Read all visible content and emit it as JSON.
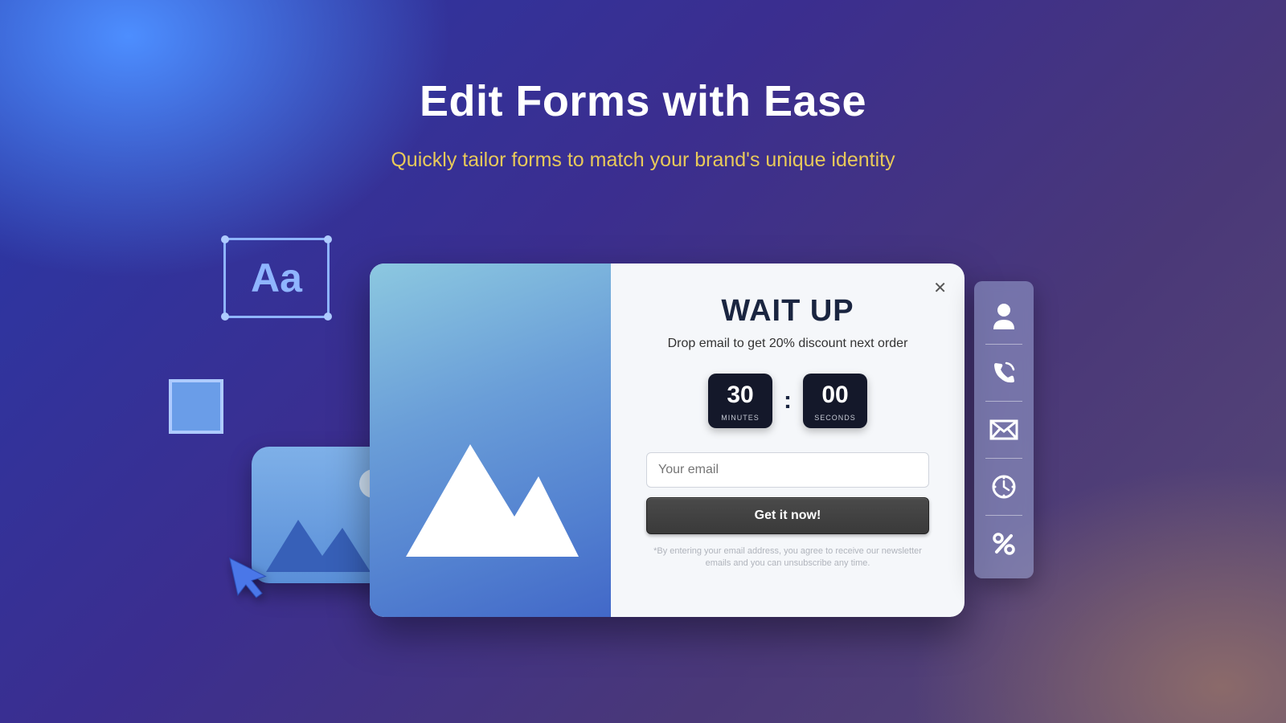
{
  "hero": {
    "title": "Edit Forms with Ease",
    "subtitle": "Quickly tailor forms to match your brand's unique identity"
  },
  "textbox": {
    "label": "Aa"
  },
  "modal": {
    "heading": "WAIT UP",
    "subheading": "Drop email to get 20% discount next order",
    "countdown": {
      "minutes": "30",
      "minutes_label": "MINUTES",
      "seconds": "00",
      "seconds_label": "SECONDS",
      "separator": ":"
    },
    "email_placeholder": "Your email",
    "button_label": "Get it now!",
    "disclaimer": "*By entering your email address, you agree to receive our newsletter emails and you can unsubscribe any time.",
    "close_label": "✕"
  },
  "sidebar": {
    "items": [
      "user-icon",
      "phone-icon",
      "mail-icon",
      "clock-icon",
      "percent-icon"
    ]
  }
}
